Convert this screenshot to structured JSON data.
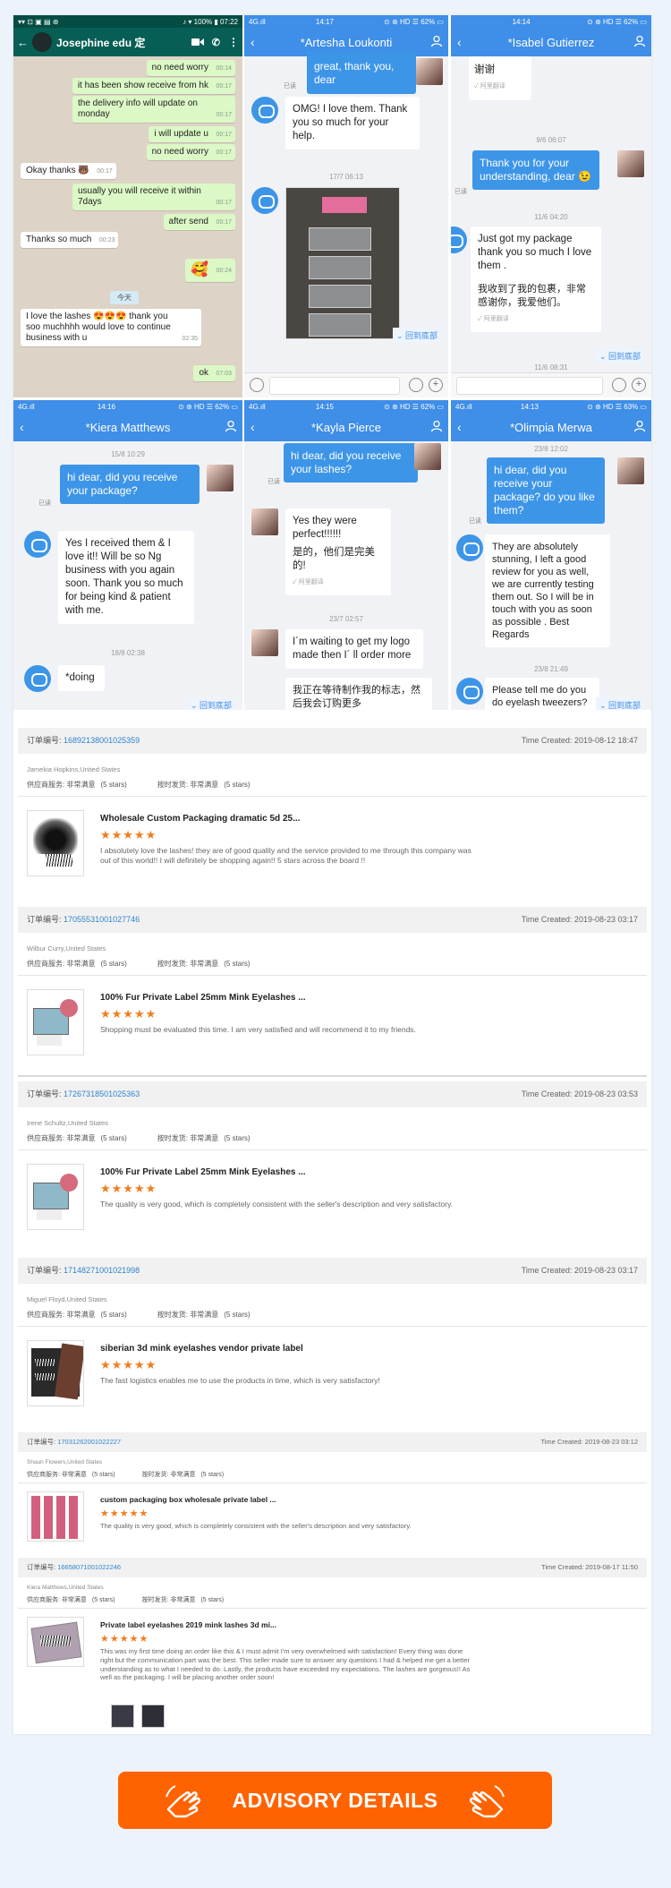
{
  "whatsapp": {
    "status_left": "▾▾ ⊡ ▣ ▤ ⊛",
    "status_right": "♪ ▾ 100% ▮ 07:22",
    "contact": "Josephine edu 定",
    "messages": [
      {
        "dir": "out",
        "text": "no need worry",
        "time": "00:14"
      },
      {
        "dir": "out",
        "text": "it has been show receive from hk",
        "time": "00:17"
      },
      {
        "dir": "out",
        "text": "the delivery info will update on monday",
        "time": "00:17"
      },
      {
        "dir": "out",
        "text": "i will update u",
        "time": "00:17"
      },
      {
        "dir": "out",
        "text": "no need worry",
        "time": "00:17"
      },
      {
        "dir": "in",
        "text": "Okay thanks 🐻",
        "time": "00:17"
      },
      {
        "dir": "out",
        "text": "usually you will receive it within 7days",
        "time": "00:17"
      },
      {
        "dir": "out",
        "text": "after send",
        "time": "00:17"
      },
      {
        "dir": "in",
        "text": "Thanks so much",
        "time": "00:23"
      },
      {
        "dir": "out",
        "text": "🥰",
        "time": "00:24"
      },
      {
        "dir": "day",
        "text": "今天"
      },
      {
        "dir": "in",
        "text": "I love the lashes 😍😍😍 thank you soo muchhhh would love to continue business with u",
        "time": "02:35"
      },
      {
        "dir": "out",
        "text": "ok",
        "time": "07:03"
      }
    ]
  },
  "chat_artesha": {
    "status_left": "4G.ıll",
    "time": "14:17",
    "status_right": "⊙ ⊛ HD ☰ 62% ▭",
    "name": "*Artesha Loukonti",
    "msg1": "great, thank you, dear",
    "read1": "已读",
    "msg2": "OMG! I love them. Thank you so much for your help.",
    "date": "17/7 06:13",
    "back_bottom": "⌄ 回到底部"
  },
  "chat_isabel": {
    "status_left": "",
    "time": "14:14",
    "status_right": "⊙ ⊛ HD ☰ 62% ▭",
    "name": "*Isabel Gutierrez",
    "msg1": "谢谢",
    "tag1": "✓ 阿里翻译",
    "date1": "9/6 06:07",
    "msg2": "Thank you for your understanding, dear 😉",
    "read": "已读",
    "date2": "11/6 04:20",
    "msg3": "Just got my package thank you so much I love them .",
    "msg3_cn": "我收到了我的包裹，非常感谢你，我爱他们。",
    "tag3": "✓ 阿里翻译",
    "back_bottom": "⌄ 回到底部",
    "date3": "11/6 08:31"
  },
  "chat_kiera": {
    "status_left": "4G.ıll",
    "time": "14:16",
    "status_right": "⊙ ⊛ HD ☰ 62% ▭",
    "name": "*Kiera Matthews",
    "date1": "15/8 10:29",
    "msg1": "hi dear, did you receive your package?",
    "read": "已读",
    "msg2": "Yes I received them & I love it!! Will be so Ng business with you again soon. Thank you so much for being kind & patient with me.",
    "date2": "18/8 02:38",
    "msg3": "*doing",
    "back_bottom": "⌄ 回到底部"
  },
  "chat_kayla": {
    "status_left": "4G.ıll",
    "time": "14:15",
    "status_right": "⊙ ⊛ HD ☰ 62% ▭",
    "name": "*Kayla Pierce",
    "msg1": "hi dear, did you receive your lashes?",
    "read": "已读",
    "msg2": "Yes they were perfect!!!!!!",
    "msg2_cn": "是的，他们是完美的!",
    "tag2": "✓ 阿里翻译",
    "date": "23/7 02:57",
    "msg3": "I´m waiting to get my logo made then I´ ll order more",
    "msg3_cn": "我正在等待制作我的标志，然后我会订购更多"
  },
  "chat_olimpia": {
    "status_left": "4G.ıll",
    "time": "14:13",
    "status_right": "⊙ ⊛ HD ☰ 63% ▭",
    "name": "*Olimpia Merwa",
    "date1": "23/8 12:02",
    "msg1": "hi dear, did you receive your package?  do you like them?",
    "read": "已读",
    "msg2": "They are absolutely stunning, I left a good review for you as well, we are currently testing them out. So I will be in touch with you as soon as possible . Best Regards",
    "date2": "23/8 21:49",
    "msg3": "Please tell me do you do eyelash tweezers?",
    "back_bottom": "⌄ 回到底部"
  },
  "orders": [
    {
      "num_label": "订单编号:",
      "num": "16892138001025359",
      "time": "Time Created: 2019-08-12 18:47",
      "buyer": "Jamekia Hopkins,United States",
      "rate1": "供应商服务: 非常满意",
      "rate1s": "(5 stars)",
      "rate2": "按时发货: 非常满意",
      "rate2s": "(5 stars)",
      "title": "Wholesale Custom Packaging dramatic 5d 25...",
      "stars": "★★★★★",
      "comment": "I absolutely love the lashes! they are of good quality and the service provided to me through this company was out of this world!! I will definitely be shopping again!!  5 stars across the board !!"
    },
    {
      "num_label": "订单编号:",
      "num": "17055531001027746",
      "time": "Time Created: 2019-08-23 03:17",
      "buyer": "Wilbur Curry,United States",
      "rate1": "供应商服务: 非常满意",
      "rate1s": "(5 stars)",
      "rate2": "按时发货: 非常满意",
      "rate2s": "(5 stars)",
      "title": "100% Fur Private Label 25mm Mink Eyelashes ...",
      "stars": "★★★★★",
      "comment": "Shopping must be evaluated this time. I am very satisfied and will recommend it to my friends."
    },
    {
      "num_label": "订单编号:",
      "num": "17267318501025363",
      "time": "Time Created: 2019-08-23 03:53",
      "buyer": "Irene Schultz,United States",
      "rate1": "供应商服务: 非常满意",
      "rate1s": "(5 stars)",
      "rate2": "按时发货: 非常满意",
      "rate2s": "(5 stars)",
      "title": "100% Fur Private Label 25mm Mink Eyelashes ...",
      "stars": "★★★★★",
      "comment": "The quality is very good, which is completely consistent with the seller's description and very satisfactory."
    },
    {
      "num_label": "订单编号:",
      "num": "17148271001021998",
      "time": "Time Created: 2019-08-23 03:17",
      "buyer": "Miguel Floyd,United States",
      "rate1": "供应商服务: 非常满意",
      "rate1s": "(5 stars)",
      "rate2": "按时发货: 非常满意",
      "rate2s": "(5 stars)",
      "title": "siberian 3d mink eyelashes vendor private label",
      "stars": "★★★★★",
      "comment": "The fast logistics enables me to use the products in time, which is very satisfactory!"
    },
    {
      "num_label": "订单编号:",
      "num": "17031262001022227",
      "time": "Time Created: 2019-08-23 03:12",
      "buyer": "Shaun Flowers,United States",
      "rate1": "供应商服务: 非常满意",
      "rate1s": "(5 stars)",
      "rate2": "按时发货: 非常满意",
      "rate2s": "(5 stars)",
      "title": "custom packaging box wholesale private label ...",
      "stars": "★★★★★",
      "comment": "The quality is very good, which is completely consistent with the seller's description and very satisfactory."
    },
    {
      "num_label": "订单编号:",
      "num": "16658071001022246",
      "time": "Time Created: 2019-08-17 11:50",
      "buyer": "Kiera Matthews,United States",
      "rate1": "供应商服务: 非常满意",
      "rate1s": "(5 stars)",
      "rate2": "按时发货: 非常满意",
      "rate2s": "(5 stars)",
      "title": "Private label eyelashes 2019 mink lashes 3d mi...",
      "stars": "★★★★★",
      "comment": "This was my first time doing an order like this & I must admit I'm very overwhelmed with satisfaction! Every thing was done right but the communication part was the best. This seller made sure to answer any questions I had & helped me get a better understanding as to what I needed to do. Lastly, the products have exceeded my expectations. The lashes are gorgeous!! As well as the packaging. I will be placing another order soon!"
    }
  ],
  "advisory_label": "ADVISORY DETAILS",
  "colors": {
    "accent": "#ff6300",
    "im_blue": "#3f8ee8",
    "whatsapp_green": "#075e54",
    "stars": "#f07d1e"
  }
}
